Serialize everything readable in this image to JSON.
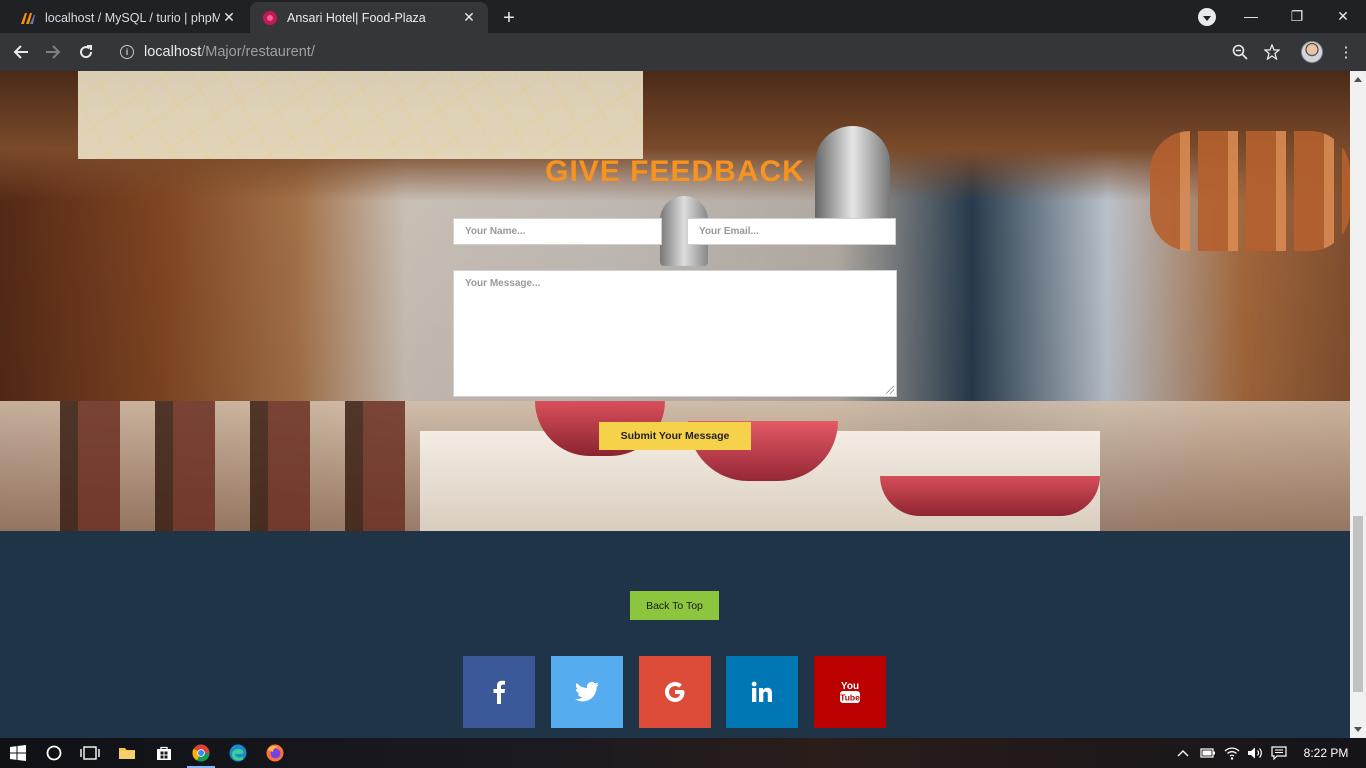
{
  "browser": {
    "tabs": [
      {
        "title": "localhost / MySQL / turio | phpM",
        "active": false,
        "favicon": "phpmyadmin-icon"
      },
      {
        "title": "Ansari Hotel| Food-Plaza",
        "active": true,
        "favicon": "site-favicon"
      }
    ],
    "url_host": "localhost",
    "url_path": "/Major/restaurent/"
  },
  "feedback": {
    "title": "GIVE FEEDBACK",
    "name_placeholder": "Your Name...",
    "email_placeholder": "Your Email...",
    "message_placeholder": "Your Message...",
    "submit_label": "Submit Your Message"
  },
  "footer": {
    "back_to_top_label": "Back To Top",
    "social": [
      {
        "name": "facebook",
        "glyph": "f",
        "color": "#3b5998"
      },
      {
        "name": "twitter",
        "glyph": "twitter-bird",
        "color": "#55acee"
      },
      {
        "name": "google",
        "glyph": "G",
        "color": "#dd4b39"
      },
      {
        "name": "linkedin",
        "glyph": "in",
        "color": "#0077b5"
      },
      {
        "name": "youtube",
        "glyph": "You Tube",
        "color": "#bb0000"
      }
    ]
  },
  "taskbar": {
    "clock": "8:22 PM"
  },
  "colors": {
    "accent_title": "#f7931e",
    "submit_button": "#f6d24a",
    "back_to_top": "#8cc63e",
    "footer_bg": "#1f3446"
  }
}
